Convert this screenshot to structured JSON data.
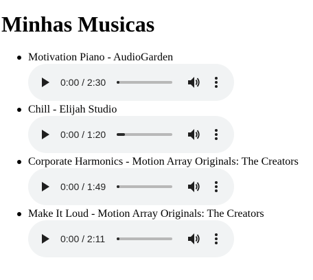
{
  "page": {
    "title": "Minhas Musicas"
  },
  "tracks": [
    {
      "title": "Motivation Piano - AudioGarden",
      "time": "0:00 / 2:30",
      "progress": 0.0
    },
    {
      "title": "Chill - Elijah Studio",
      "time": "0:00 / 1:20",
      "progress": 0.1
    },
    {
      "title": "Corporate Harmonics - Motion Array Originals: The Creators",
      "time": "0:00 / 1:49",
      "progress": 0.0
    },
    {
      "title": "Make It Loud - Motion Array Originals: The Creators",
      "time": "0:00 / 2:11",
      "progress": 0.0
    }
  ],
  "player_icons": {
    "play": "play-icon",
    "volume": "volume-icon",
    "more": "more-vertical-icon"
  },
  "colors": {
    "player_background": "#f1f3f4",
    "track_bar": "#b8b8b8",
    "track_fill": "#2a2a2a",
    "icon": "#1f1f1f"
  }
}
